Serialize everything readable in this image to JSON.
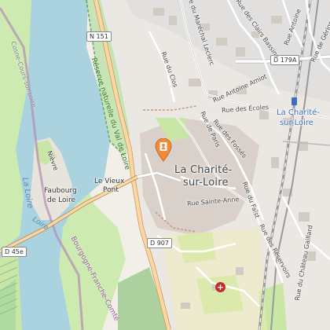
{
  "map": {
    "roads": {
      "n151": "N 151",
      "d179a": "D 179A",
      "d907": "D 907",
      "d45e": "D 45e"
    },
    "streets": {
      "marechal_leclerc": "Rue du Maréchal Leclerc",
      "rue_du_clos": "Rue du Clos",
      "clairs_bassins": "Rue des Clairs Bassins",
      "antoine_amiot": "Rue Antoine Amiot",
      "rue_des_ecoles": "Rue des Écoles",
      "rue_de_paris": "Rue de Paris",
      "rue_des_fosses": "Rue des Fossés",
      "rue_sainte_anne": "Rue Sainte-Anne",
      "rue_du_faist": "Rue du Faîst",
      "rue_des_reservoirs": "Rue des Réservoirs",
      "rue_du_chateau_gaillard": "Rue du Château Gaillard",
      "rue_de_gerigny": "Rue de Gérigny",
      "rue_antoine": "Rue Antoine"
    },
    "places": {
      "town_line1": "La Charité-",
      "town_line2": "sur-Loire",
      "station_line1": "La Charité-",
      "station_line2": "sur-Loire",
      "faubourg_line1": "Faubourg",
      "faubourg_line2": "de Loire",
      "vieux_pont_line1": "Le Vieux",
      "vieux_pont_line2": "Pont",
      "nievre": "Nièvre"
    },
    "water": {
      "la_loire": "La Loire",
      "loire_short": "Loire"
    },
    "areas": {
      "reserve": "Réserve naturelle du Val de Loire",
      "cosne": "Cosne-Cours-sur-Loire",
      "bfc": "Bourgogne-Franche-Comté"
    },
    "markers": {
      "poi": "location-pin-icon",
      "hospital": "hospital-icon",
      "hospital_symbol": "+",
      "station": "train-station-icon"
    },
    "colors": {
      "water": "#aad3df",
      "land": "#f2efe9",
      "built": "#e0dfdf",
      "green": "#c8e6a6",
      "primary_road": "#fcd6a4",
      "rail": "#999999",
      "boundary": "#b28db2",
      "poi_marker": "#f08a3a",
      "hospital": "#c72c2c"
    }
  }
}
